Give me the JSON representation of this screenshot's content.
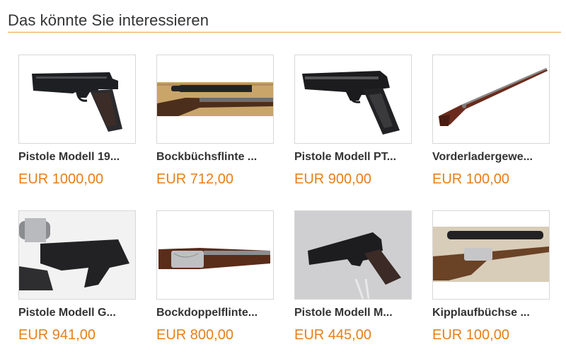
{
  "section": {
    "title": "Das könnte Sie interessieren"
  },
  "products": [
    {
      "name": "Pistole Modell 19...",
      "price": "EUR 1000,00"
    },
    {
      "name": "Bockbüchsflinte ...",
      "price": "EUR 712,00"
    },
    {
      "name": "Pistole Modell PT...",
      "price": "EUR 900,00"
    },
    {
      "name": "Vorderladergewe...",
      "price": "EUR 100,00"
    },
    {
      "name": "Pistole Modell G...",
      "price": "EUR 941,00"
    },
    {
      "name": "Bockdoppelflinte...",
      "price": "EUR 800,00"
    },
    {
      "name": "Pistole Modell M...",
      "price": "EUR 445,00"
    },
    {
      "name": "Kipplaufbüchse ...",
      "price": "EUR 100,00"
    }
  ],
  "colors": {
    "accent": "#e8a34c",
    "price": "#e87e1a",
    "text": "#333333",
    "border": "#d7d7d7"
  }
}
